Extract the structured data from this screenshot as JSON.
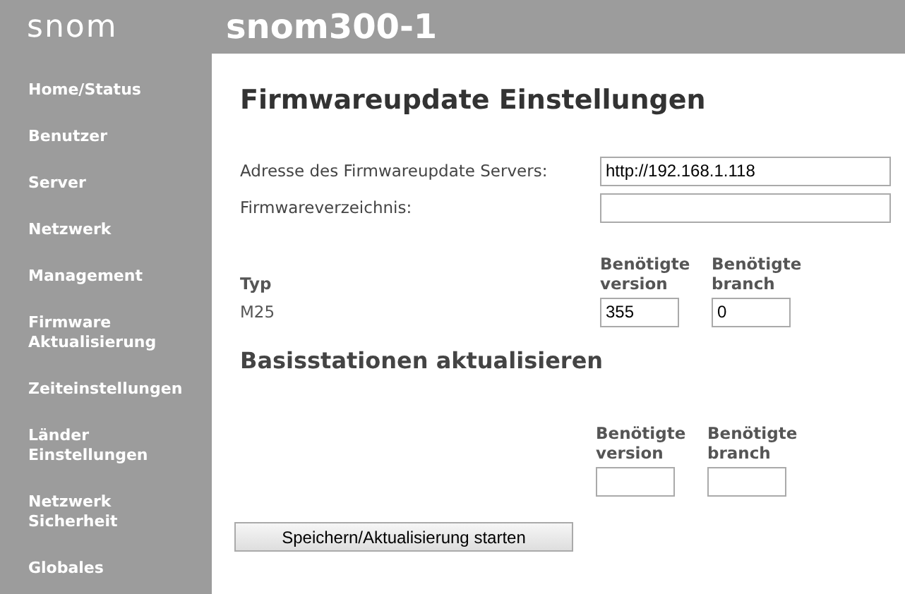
{
  "header": {
    "logo": "snom",
    "title": "snom300-1"
  },
  "sidebar": {
    "items": [
      {
        "lines": [
          "Home/Status"
        ]
      },
      {
        "lines": [
          "Benutzer"
        ]
      },
      {
        "lines": [
          "Server"
        ]
      },
      {
        "lines": [
          "Netzwerk"
        ]
      },
      {
        "lines": [
          "Management"
        ]
      },
      {
        "lines": [
          "Firmware",
          "Aktualisierung"
        ]
      },
      {
        "lines": [
          "Zeiteinstellungen"
        ]
      },
      {
        "lines": [
          "Länder",
          "Einstellungen"
        ]
      },
      {
        "lines": [
          "Netzwerk",
          "Sicherheit"
        ]
      },
      {
        "lines": [
          "Globales"
        ]
      }
    ]
  },
  "page": {
    "heading": "Firmwareupdate Einstellungen",
    "fields": [
      {
        "label": "Adresse des Firmwareupdate Servers:",
        "value": "http://192.168.1.118"
      },
      {
        "label": "Firmwareverzeichnis:"
      }
    ],
    "table": {
      "columns": [
        {
          "lines": [
            "Typ"
          ]
        },
        {
          "lines": [
            "Benötigte",
            "version"
          ]
        },
        {
          "lines": [
            "Benötigte",
            "branch"
          ]
        }
      ],
      "rows": [
        {
          "type": "M25",
          "version": "355",
          "branch": "0"
        }
      ]
    },
    "section_heading": "Basisstationen aktualisieren",
    "base_table": {
      "columns": [
        {
          "lines": [
            "Benötigte",
            "version"
          ]
        },
        {
          "lines": [
            "Benötigte",
            "branch"
          ]
        }
      ],
      "rows": [
        {}
      ]
    },
    "button": "Speichern/Aktualisierung starten"
  }
}
